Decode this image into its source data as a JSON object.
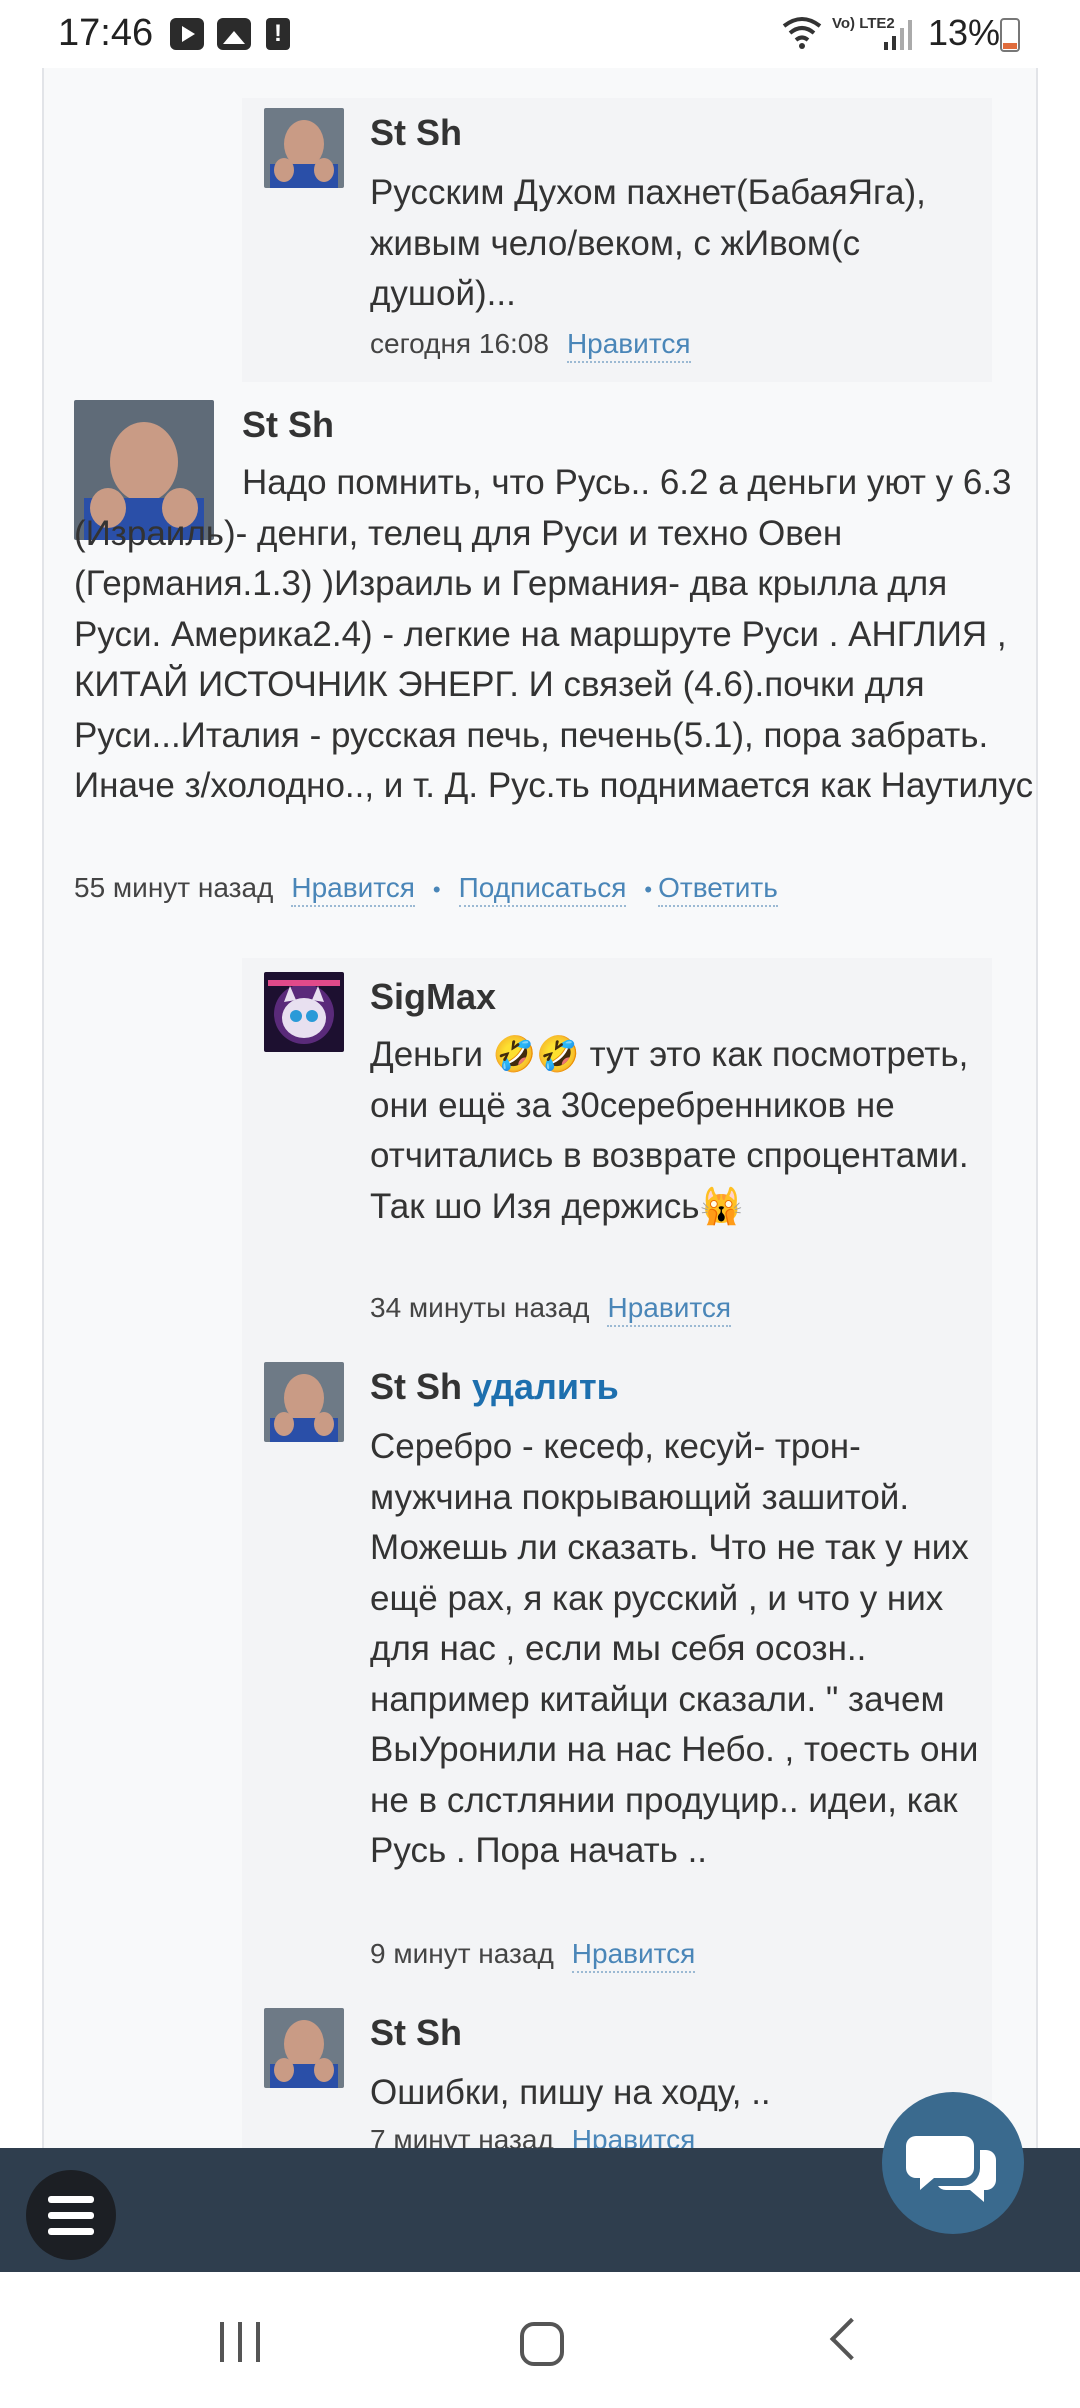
{
  "status_bar": {
    "time": "17:46",
    "network": "Vo) LTE2",
    "battery": "13%",
    "icons": [
      "youtube-icon",
      "gallery-icon",
      "alert-icon",
      "wifi-icon",
      "signal-icon",
      "battery-icon"
    ]
  },
  "comments": [
    {
      "author": "St Sh",
      "text": "Русским Духом пахнет(БабаяЯга), живым чело/веком, с жИвом(с душой)...",
      "time": "сегодня 16:08",
      "like": "Нравится"
    },
    {
      "author": "St Sh",
      "text": "Надо помнить, что Русь.. 6.2 а деньги уют у 6.3 (Израиль)- денги, телец для Руси и техно Овен (Германия.1.3) )Израиль и Германия- два крылла для Руси. Америка2.4) - легкие на маршруте Руси . АНГЛИЯ , КИТАЙ ИСТОЧНИК ЭНЕРГ. И связей (4.6).почки для Руси...Италия - русская печь, печень(5.1), пора забрать. Иначе з/холодно.., и т. Д. Рус.ть поднимается как Наутилус",
      "time": "55 минут назад",
      "like": "Нравится",
      "subscribe": "Подписаться",
      "reply": "Ответить"
    },
    {
      "author": "SigMax",
      "text": "Деньги 🤣🤣 тут это как посмотреть, они ещё за 30серебренников не отчитались в возврате спроцентами. Так шо Изя держись🙀",
      "time": "34 минуты назад",
      "like": "Нравится"
    },
    {
      "author": "St Sh",
      "delete": "удалить",
      "text": "Серебро - кесеф, кесуй- трон- мужчина покрывающий зашитой. Можешь ли сказать. Что не так у них ещё рах, я как русский , и что у них для нас , если мы себя осозн.. например китайци сказали. \" зачем ВыУронили на нас Небо. , тоесть они не в слстлянии продуцир.. идеи, как Русь . Пора начать ..",
      "time": "9 минут назад",
      "like": "Нравится"
    },
    {
      "author": "St Sh",
      "text": "Ошибки, пишу на ходу, ..",
      "time": "7 минут назад",
      "like": "Нравится"
    }
  ],
  "toolbar": {
    "menu_icon": "hamburger-menu-icon",
    "chat_icon": "chat-bubbles-icon"
  },
  "nav": {
    "recent": "recent-apps-icon",
    "home": "home-icon",
    "back": "back-icon"
  }
}
